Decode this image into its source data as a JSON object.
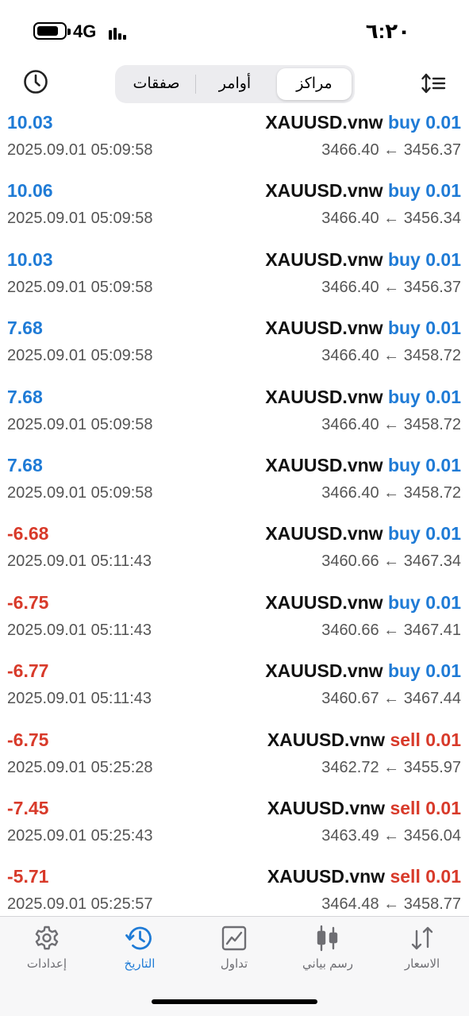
{
  "status_bar": {
    "network": "4G",
    "time": "٦:٢٠"
  },
  "header": {
    "segments": [
      {
        "label": "صفقات"
      },
      {
        "label": "أوامر"
      },
      {
        "label": "مراكز",
        "selected": true
      }
    ]
  },
  "trades": [
    {
      "profit": "10.03",
      "datetime": "2025.09.01 05:09:58",
      "symbol": "XAUUSD.vnw",
      "side": "buy",
      "volume": "0.01",
      "price_from": "3456.37",
      "price_to": "3466.40"
    },
    {
      "profit": "10.06",
      "datetime": "2025.09.01 05:09:58",
      "symbol": "XAUUSD.vnw",
      "side": "buy",
      "volume": "0.01",
      "price_from": "3456.34",
      "price_to": "3466.40"
    },
    {
      "profit": "10.03",
      "datetime": "2025.09.01 05:09:58",
      "symbol": "XAUUSD.vnw",
      "side": "buy",
      "volume": "0.01",
      "price_from": "3456.37",
      "price_to": "3466.40"
    },
    {
      "profit": "7.68",
      "datetime": "2025.09.01 05:09:58",
      "symbol": "XAUUSD.vnw",
      "side": "buy",
      "volume": "0.01",
      "price_from": "3458.72",
      "price_to": "3466.40"
    },
    {
      "profit": "7.68",
      "datetime": "2025.09.01 05:09:58",
      "symbol": "XAUUSD.vnw",
      "side": "buy",
      "volume": "0.01",
      "price_from": "3458.72",
      "price_to": "3466.40"
    },
    {
      "profit": "7.68",
      "datetime": "2025.09.01 05:09:58",
      "symbol": "XAUUSD.vnw",
      "side": "buy",
      "volume": "0.01",
      "price_from": "3458.72",
      "price_to": "3466.40"
    },
    {
      "profit": "-6.68",
      "datetime": "2025.09.01 05:11:43",
      "symbol": "XAUUSD.vnw",
      "side": "buy",
      "volume": "0.01",
      "price_from": "3467.34",
      "price_to": "3460.66"
    },
    {
      "profit": "-6.75",
      "datetime": "2025.09.01 05:11:43",
      "symbol": "XAUUSD.vnw",
      "side": "buy",
      "volume": "0.01",
      "price_from": "3467.41",
      "price_to": "3460.66"
    },
    {
      "profit": "-6.77",
      "datetime": "2025.09.01 05:11:43",
      "symbol": "XAUUSD.vnw",
      "side": "buy",
      "volume": "0.01",
      "price_from": "3467.44",
      "price_to": "3460.67"
    },
    {
      "profit": "-6.75",
      "datetime": "2025.09.01 05:25:28",
      "symbol": "XAUUSD.vnw",
      "side": "sell",
      "volume": "0.01",
      "price_from": "3455.97",
      "price_to": "3462.72"
    },
    {
      "profit": "-7.45",
      "datetime": "2025.09.01 05:25:43",
      "symbol": "XAUUSD.vnw",
      "side": "sell",
      "volume": "0.01",
      "price_from": "3456.04",
      "price_to": "3463.49"
    },
    {
      "profit": "-5.71",
      "datetime": "2025.09.01 05:25:57",
      "symbol": "XAUUSD.vnw",
      "side": "sell",
      "volume": "0.01",
      "price_from": "3458.77",
      "price_to": "3464.48"
    }
  ],
  "tabbar": {
    "tabs": [
      {
        "label": "إعدادات",
        "icon": "gear-icon"
      },
      {
        "label": "التاريخ",
        "icon": "history-icon",
        "active": true
      },
      {
        "label": "تداول",
        "icon": "trade-chart-icon"
      },
      {
        "label": "رسم بياني",
        "icon": "candlestick-icon"
      },
      {
        "label": "الاسعار",
        "icon": "quotes-arrows-icon"
      }
    ]
  },
  "colors": {
    "accent": "#1f7bd6",
    "loss": "#d83a2a",
    "text_secondary": "#555555"
  }
}
